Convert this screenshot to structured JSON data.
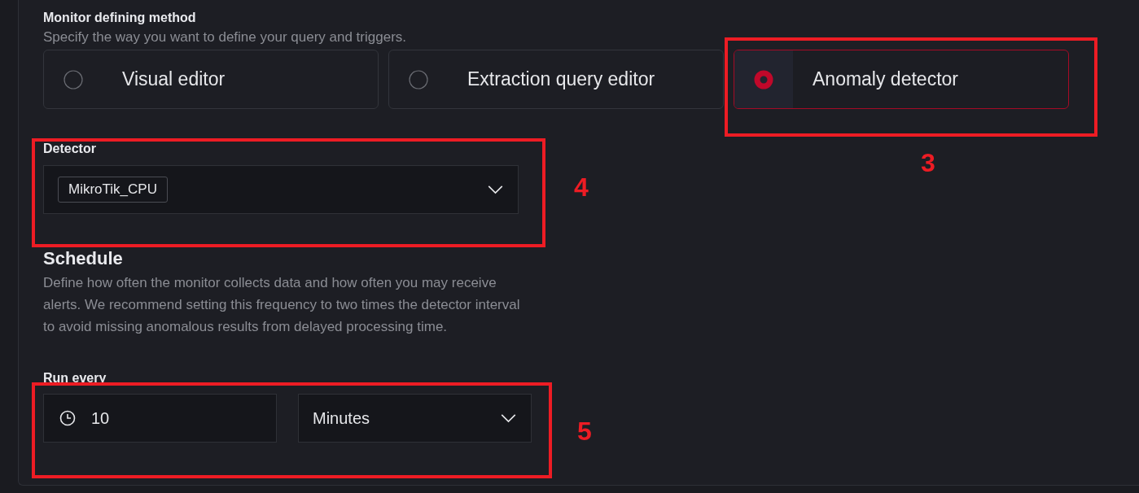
{
  "method": {
    "title": "Monitor defining method",
    "description": "Specify the way you want to define your query and triggers.",
    "options": [
      {
        "label": "Visual editor",
        "selected": false
      },
      {
        "label": "Extraction query editor",
        "selected": false
      },
      {
        "label": "Anomaly detector",
        "selected": true
      }
    ]
  },
  "detector": {
    "label": "Detector",
    "value": "MikroTik_CPU"
  },
  "schedule": {
    "title": "Schedule",
    "description": "Define how often the monitor collects data and how often you may receive alerts. We recommend setting this frequency to two times the detector interval to avoid missing anomalous results from delayed processing time.",
    "run_every": {
      "label": "Run every",
      "interval": "10",
      "unit": "Minutes"
    }
  },
  "annotations": [
    {
      "label": "3"
    },
    {
      "label": "4"
    },
    {
      "label": "5"
    }
  ]
}
